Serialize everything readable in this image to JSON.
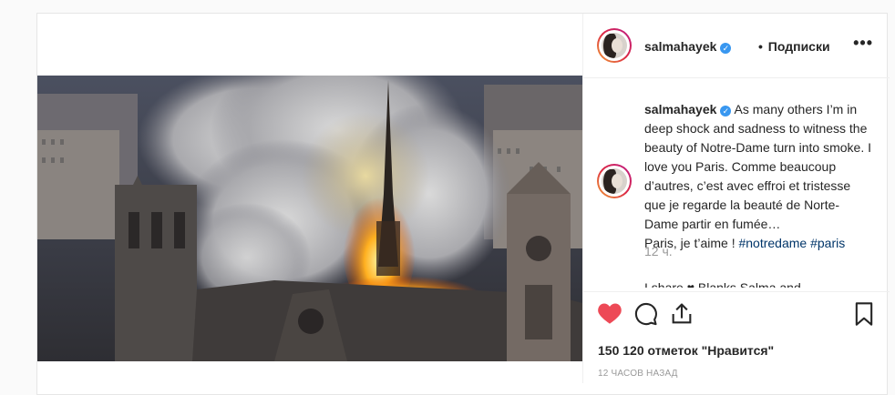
{
  "header": {
    "username": "salmahayek",
    "verified": true,
    "dot": "•",
    "follow_status": "Подписки",
    "more_label": "•••"
  },
  "caption": {
    "username": "salmahayek",
    "text": "As many others I’m in deep shock and sadness to witness the beauty of Notre-Dame turn into smoke. I love you Paris. Comme beaucoup d’autres, c’est avec effroi et tristesse que je regarde la beauté de Norte-Dame partir en fumée…",
    "line_last": "Paris, je t’aime ! ",
    "hashtag_1": "#notredame",
    "hashtag_2": "#paris",
    "time_ago": "12 ч."
  },
  "next_comment_preview": "I share  ♥ Blanks Salma and",
  "actions": {
    "like_icon": "heart-filled-icon",
    "comment_icon": "speech-bubble-icon",
    "share_icon": "share-arrow-icon",
    "save_icon": "bookmark-icon",
    "like_color": "#ed4956"
  },
  "likes_text": "150 120 отметок \"Нравится\"",
  "post_time": "12 часов назад",
  "image": {
    "subject": "notre-dame-fire-photo"
  }
}
